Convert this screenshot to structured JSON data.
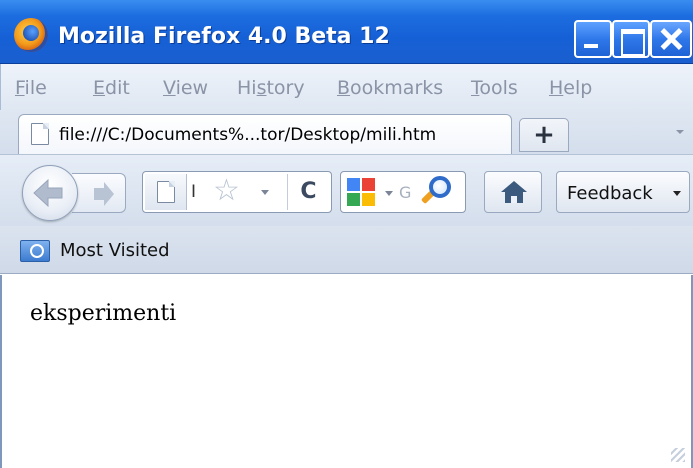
{
  "window": {
    "title": "Mozilla Firefox 4.0 Beta 12"
  },
  "menu": {
    "items": [
      {
        "label": "File",
        "accel": "F",
        "rest": "ile"
      },
      {
        "label": "Edit",
        "accel": "E",
        "rest": "dit"
      },
      {
        "label": "View",
        "accel": "V",
        "rest": "iew"
      },
      {
        "label": "History",
        "pre": "Hi",
        "accel": "s",
        "rest": "tory"
      },
      {
        "label": "Bookmarks",
        "accel": "B",
        "rest": "ookmarks"
      },
      {
        "label": "Tools",
        "accel": "T",
        "rest": "ools"
      },
      {
        "label": "Help",
        "accel": "H",
        "rest": "elp"
      }
    ]
  },
  "tabs": {
    "active": {
      "label": "file:///C:/Documents%...tor/Desktop/mili.htm",
      "icon": "page-icon"
    },
    "new_tab_label": "+"
  },
  "navbar": {
    "url_value": "I",
    "reload_glyph": "C",
    "search_placeholder": "G",
    "feedback_label": "Feedback"
  },
  "bookmarks_toolbar": {
    "items": [
      {
        "label": "Most Visited",
        "icon": "most-visited-folder-icon"
      }
    ]
  },
  "content": {
    "text": "eksperimenti"
  },
  "colors": {
    "titlebar": "#1c6de0",
    "toolbar": "#dfe7f2",
    "content_bg": "#ffffff"
  }
}
